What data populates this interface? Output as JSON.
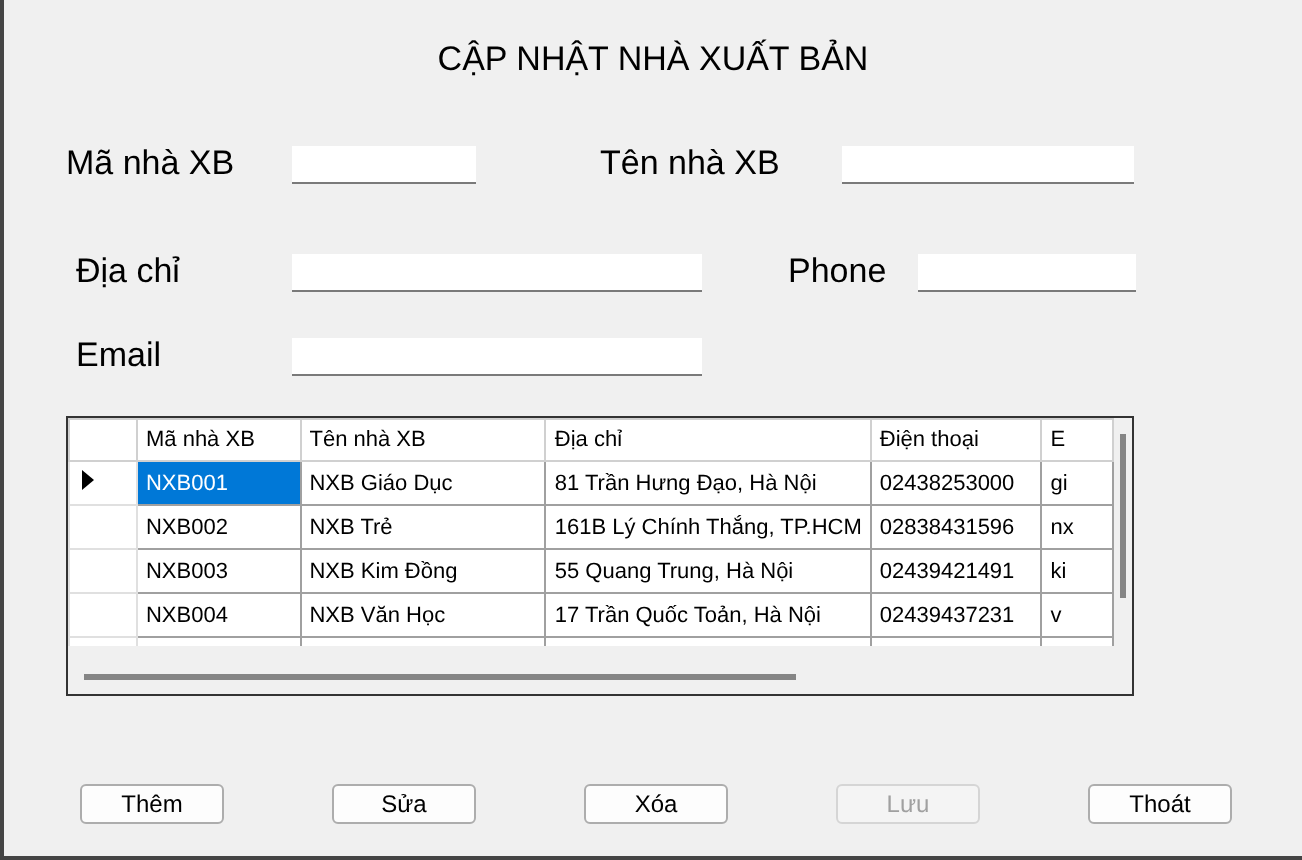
{
  "title": "CẬP NHẬT NHÀ XUẤT BẢN",
  "fields": [
    {
      "label": "Mã nhà XB"
    },
    {
      "label": "Tên nhà XB"
    },
    {
      "label": "Địa chỉ"
    },
    {
      "label": "Phone"
    },
    {
      "label": "Email"
    }
  ],
  "table": {
    "columns": [
      "Mã nhà XB",
      "Tên nhà XB",
      "Địa chỉ",
      "Điện thoại",
      "E"
    ],
    "rows": [
      {
        "cells": [
          "NXB001",
          "NXB Giáo Dục",
          "81 Trần Hưng Đạo, Hà Nội",
          "02438253000",
          "gi"
        ],
        "selected": true
      },
      {
        "cells": [
          "NXB002",
          "NXB Trẻ",
          "161B Lý Chính Thắng, TP.HCM",
          "02838431596",
          "nx"
        ],
        "selected": false
      },
      {
        "cells": [
          "NXB003",
          "NXB Kim Đồng",
          "55 Quang Trung, Hà Nội",
          "02439421491",
          "ki"
        ],
        "selected": false
      },
      {
        "cells": [
          "NXB004",
          "NXB Văn Học",
          "17 Trần Quốc Toản, Hà Nội",
          "02439437231",
          "v"
        ],
        "selected": false
      }
    ]
  },
  "buttons": [
    {
      "label": "Thêm",
      "disabled": false
    },
    {
      "label": "Sửa",
      "disabled": false
    },
    {
      "label": "Xóa",
      "disabled": false
    },
    {
      "label": "Lưu",
      "disabled": true
    },
    {
      "label": "Thoát",
      "disabled": false
    }
  ]
}
